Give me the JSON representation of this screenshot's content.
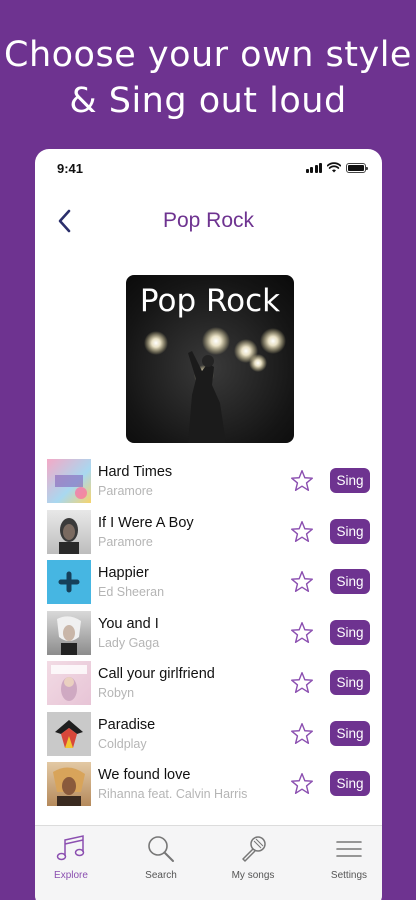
{
  "headline": {
    "line1": "Choose your own style",
    "line2": "& Sing out loud"
  },
  "status_bar": {
    "time": "9:41"
  },
  "nav": {
    "title": "Pop Rock"
  },
  "cover": {
    "title": "Pop Rock"
  },
  "songs": [
    {
      "title": "Hard Times",
      "artist": "Paramore",
      "action": "Sing"
    },
    {
      "title": "If I Were A Boy",
      "artist": "Paramore",
      "action": "Sing"
    },
    {
      "title": "Happier",
      "artist": "Ed Sheeran",
      "action": "Sing"
    },
    {
      "title": "You and I",
      "artist": "Lady Gaga",
      "action": "Sing"
    },
    {
      "title": "Call your girlfriend",
      "artist": "Robyn",
      "action": "Sing"
    },
    {
      "title": "Paradise",
      "artist": "Coldplay",
      "action": "Sing"
    },
    {
      "title": "We found love",
      "artist": "Rihanna feat. Calvin Harris",
      "action": "Sing"
    }
  ],
  "tabs": [
    {
      "label": "Explore",
      "icon": "music-note-icon",
      "active": true
    },
    {
      "label": "Search",
      "icon": "search-icon",
      "active": false
    },
    {
      "label": "My songs",
      "icon": "microphone-icon",
      "active": false
    },
    {
      "label": "Settings",
      "icon": "menu-icon",
      "active": false
    }
  ],
  "colors": {
    "brand": "#6e3390",
    "accent_light": "#8b4fb0",
    "background": "#ffffff",
    "tab_bar": "#f5f5f6"
  }
}
